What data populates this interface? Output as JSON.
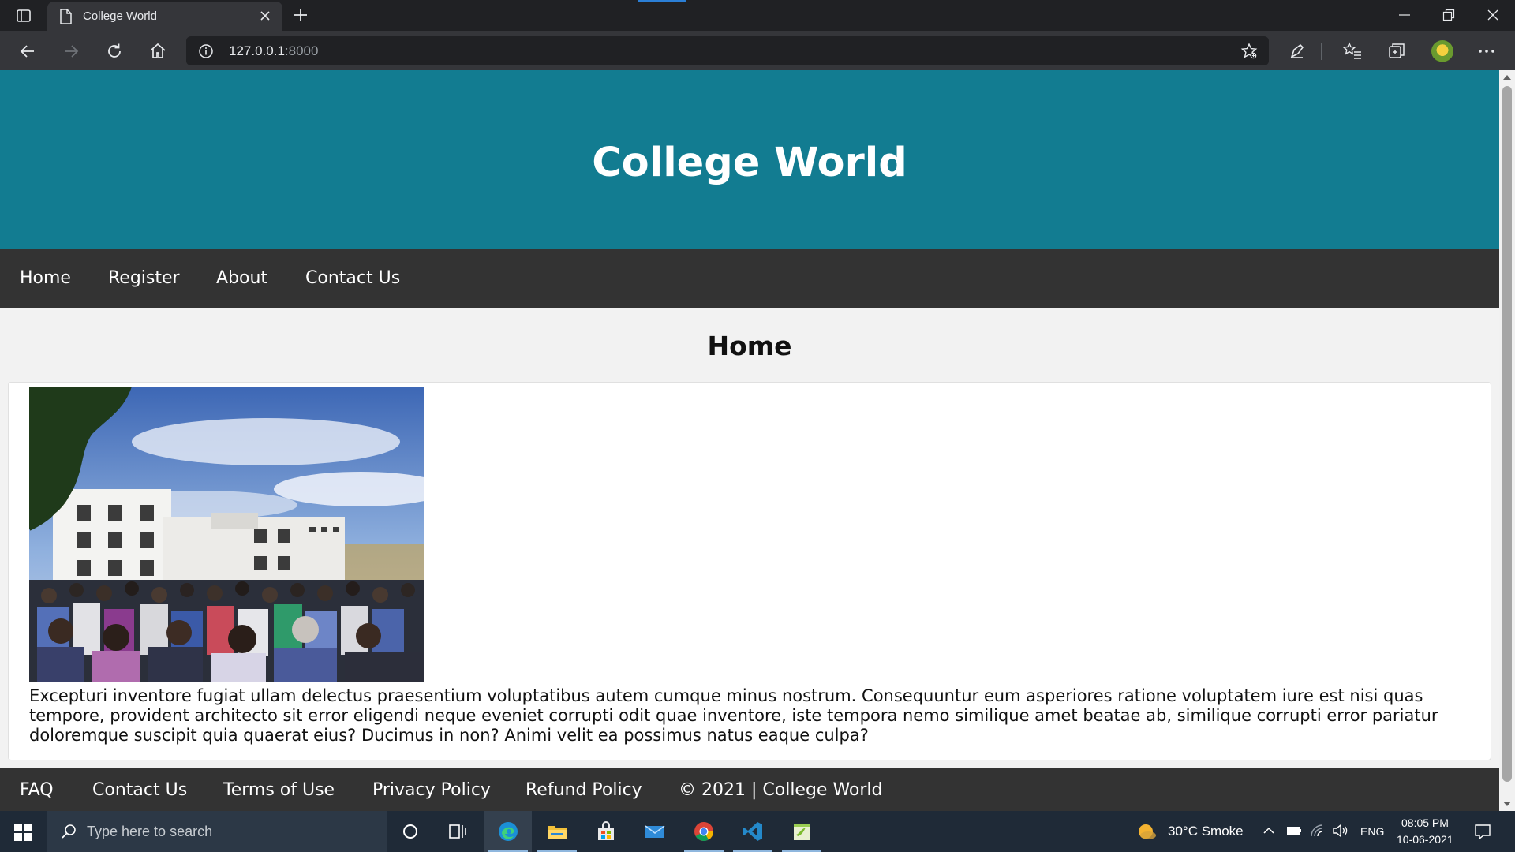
{
  "browser": {
    "tab_title": "College World",
    "url_host": "127.0.0.1",
    "url_port": ":8000"
  },
  "site": {
    "header_title": "College World",
    "nav": [
      "Home",
      "Register",
      "About",
      "Contact Us"
    ],
    "page_heading": "Home",
    "body_text": "Excepturi inventore fugiat ullam delectus praesentium voluptatibus autem cumque minus nostrum. Consequuntur eum asperiores ratione voluptatem iure est nisi quas tempore, provident architecto sit error eligendi neque eveniet corrupti odit quae inventore, iste tempora nemo similique amet beatae ab, similique corrupti error pariatur doloremque suscipit quia quaerat eius? Ducimus in non? Animi velit ea possimus natus eaque culpa?",
    "footer": [
      "FAQ",
      "Contact Us",
      "Terms of Use",
      "Privacy Policy",
      "Refund Policy",
      "© 2021 | College World"
    ]
  },
  "taskbar": {
    "search_placeholder": "Type here to search",
    "weather": "30°C  Smoke",
    "language": "ENG",
    "time": "08:05 PM",
    "date": "10-06-2021"
  },
  "colors": {
    "header": "#127c91",
    "nav": "#333333",
    "footer": "#333333",
    "page_bg": "#f2f2f2"
  }
}
